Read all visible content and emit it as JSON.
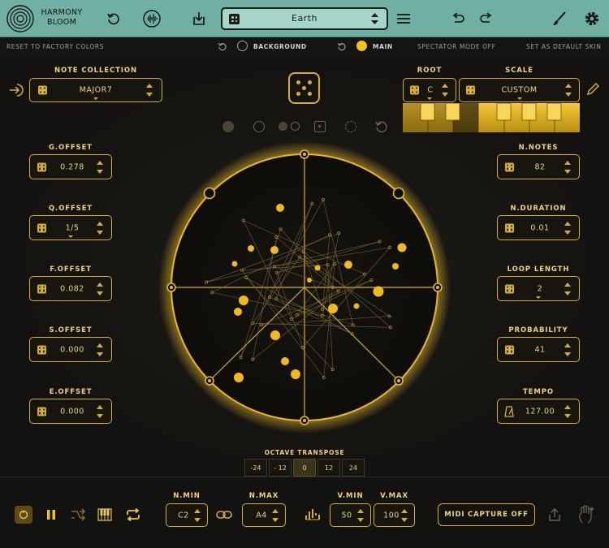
{
  "app": {
    "name_line1": "HARMONY",
    "name_line2": "BLOOM"
  },
  "toolbar": {
    "preset_name": "Earth"
  },
  "subbar": {
    "reset": "RESET TO FACTORY COLORS",
    "background": "BACKGROUND",
    "main": "MAIN",
    "spectator": "SPECTATOR MODE OFF",
    "default_skin": "SET AS DEFAULT SKIN"
  },
  "colors": {
    "accent": "#d7ae2f",
    "teal": "#6fb0a2",
    "dark": "#131210"
  },
  "note_collection": {
    "label": "NOTE COLLECTION",
    "value": "MAJOR7"
  },
  "root": {
    "label": "ROOT",
    "value": "C"
  },
  "scale": {
    "label": "SCALE",
    "value": "CUSTOM"
  },
  "left_params": [
    {
      "label": "G.OFFSET",
      "value": "0.278"
    },
    {
      "label": "Q.OFFSET",
      "value": "1/5"
    },
    {
      "label": "F.OFFSET",
      "value": "0.082"
    },
    {
      "label": "S.OFFSET",
      "value": "0.000"
    },
    {
      "label": "E.OFFSET",
      "value": "0.000"
    }
  ],
  "right_params": [
    {
      "label": "N.NOTES",
      "value": "82"
    },
    {
      "label": "N.DURATION",
      "value": "0.01"
    },
    {
      "label": "LOOP LENGTH",
      "value": "2"
    },
    {
      "label": "PROBABILITY",
      "value": "41"
    },
    {
      "label": "TEMPO",
      "value": "127.00"
    }
  ],
  "octave": {
    "label": "OCTAVE TRANSPOSE",
    "options": [
      "-24",
      "- 12",
      "0",
      "12",
      "24"
    ],
    "selected": "0"
  },
  "bottom": {
    "nmin": {
      "label": "N.MIN",
      "value": "C2"
    },
    "nmax": {
      "label": "N.MAX",
      "value": "A4"
    },
    "vmin": {
      "label": "V.MIN",
      "value": "50"
    },
    "vmax": {
      "label": "V.MAX",
      "value": "100"
    },
    "midi_capture": "MIDI CAPTURE OFF"
  }
}
